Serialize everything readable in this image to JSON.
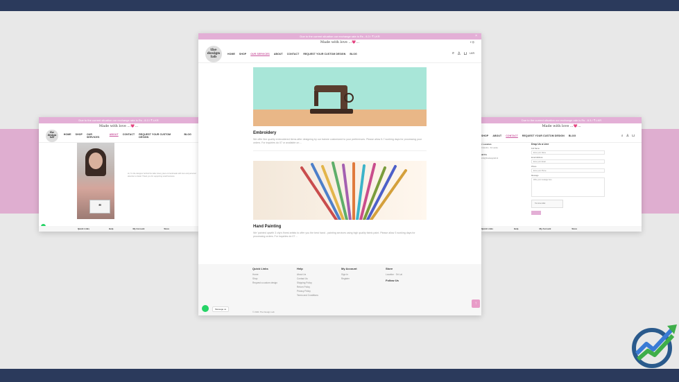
{
  "colors": {
    "navy": "#2b3a5c",
    "pink_band": "#dfaed0",
    "announce": "#e3afd6",
    "accent": "#c9549d"
  },
  "main": {
    "announcement": "Due to the current situation our exchange rate is Rs - 8.3 / ₹ LKR",
    "close": "×",
    "tagline": "Made with love ...💗...",
    "social": "f ◎",
    "logo": "the design lab",
    "nav": [
      "HOME",
      "SHOP",
      "OUR SERVICES",
      "ABOUT",
      "CONTACT",
      "REQUEST YOUR CUSTOM DESIGN",
      "BLOG"
    ],
    "currency": "LKR",
    "services": [
      {
        "title": "Embroidery",
        "desc": "We offer fine quality embroidered items after designing by our trainee customized to your preferences. Please allow 5-7 working days for processing your orders. For inquiries do 07 or available on ..."
      },
      {
        "title": "Hand Painting",
        "desc": "We 'painted upwith 3 city's finest artists to offer you the best hand - painting services using high quality fabric paint. Please allow 3 working days for processing orders. For inquiries do 07 ..."
      }
    ],
    "footer": {
      "cols": [
        {
          "heading": "Quick Links",
          "items": [
            "Home",
            "Shop",
            "Request a custom design"
          ]
        },
        {
          "heading": "Help",
          "items": [
            "About Us",
            "Contact Us",
            "Shipping Policy",
            "Return Policy",
            "Privacy Policy",
            "Terms and Conditions"
          ]
        },
        {
          "heading": "My Account",
          "items": [
            "Sign In",
            "Register"
          ]
        },
        {
          "heading": "Store",
          "items": [
            "Location · Sri Lal",
            "Follow Us"
          ]
        }
      ],
      "copyright": "© 2021 The Design Lab"
    },
    "whatsapp_label": "Message us",
    "scroll_top": "↑"
  },
  "left": {
    "announcement": "Due to the current situation our exchange rate is Rs - 8.3 / ₹ LKR",
    "tagline": "Made with love ...💗...",
    "logo": "the design lab",
    "nav": [
      "HOME",
      "SHOP",
      "OUR SERVICES",
      "ABOUT",
      "CONTACT",
      "REQUEST YOUR CUSTOM DESIGN",
      "BLOG"
    ],
    "body_text": "Hi, I'm the designer behind the label. Every piece is handmade with love and personal attention to detail. Thank you for supporting small business.",
    "quote": "❝",
    "bottom": [
      "Quick Links",
      "Help",
      "My Account",
      "Store"
    ]
  },
  "right": {
    "announcement": "Due to the current situation our exchange rate is Rs - 8.3 / ₹ LKR",
    "tagline": "Made with love ...💗...",
    "nav": [
      "SHOP",
      "ABOUT",
      "CONTACT",
      "REQUEST YOUR CUSTOM DESIGN",
      "BLOG"
    ],
    "location_heading": "r Location",
    "location_text": "Colombo · Sri Lanka",
    "email_heading": "ail Us",
    "email_text": "info@thedesignlab.lk",
    "form_heading": "Drop Us a Line",
    "fields": [
      {
        "label": "Full Name",
        "placeholder": "Enter your Name"
      },
      {
        "label": "Email Address",
        "placeholder": "Enter your Email"
      },
      {
        "label": "Phone",
        "placeholder": "Enter your Phone"
      }
    ],
    "message_label": "Message",
    "message_placeholder": "Write your message here",
    "captcha_label": "I'm not a robot",
    "bottom": [
      "Quick Links",
      "Help",
      "My Account",
      "Store"
    ]
  }
}
